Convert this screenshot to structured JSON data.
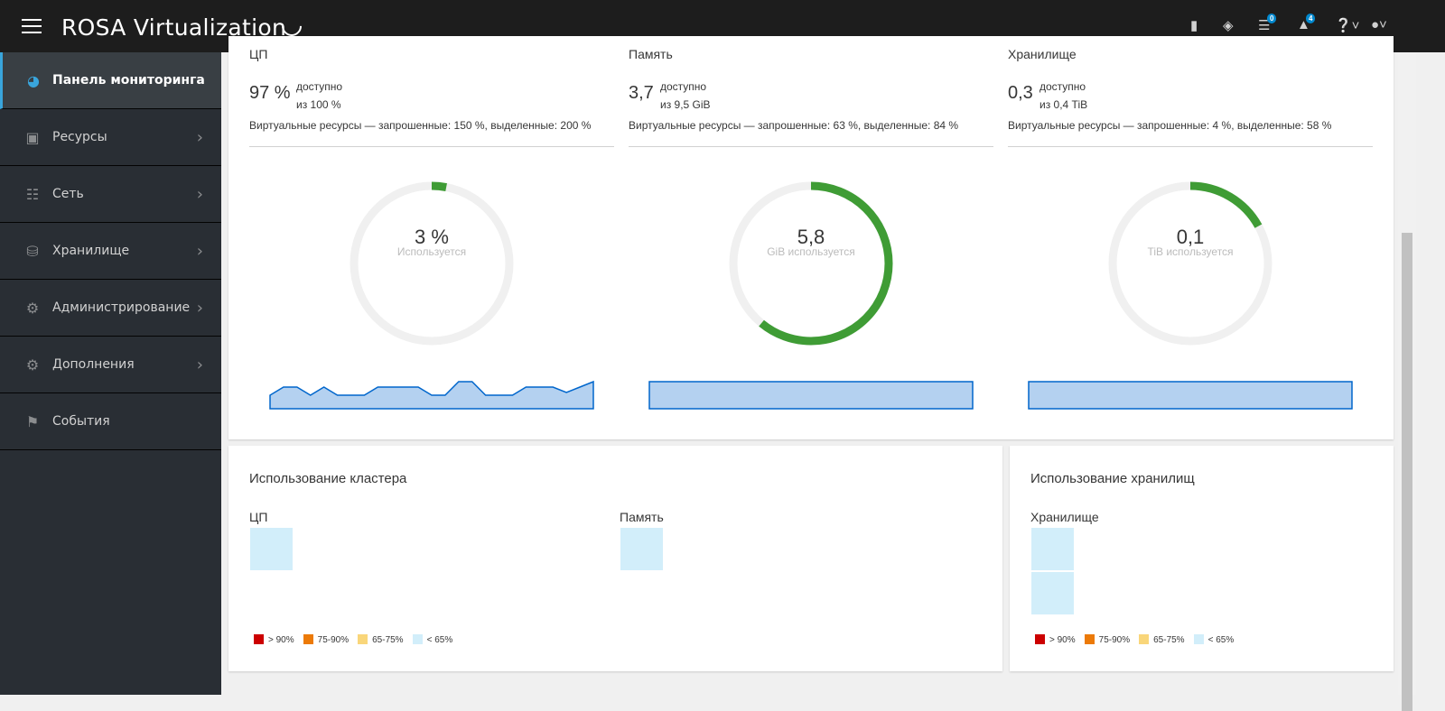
{
  "header": {
    "brand": "ROSA Virtualization",
    "messages_count": "0",
    "notifications_count": "4",
    "icons": [
      "bookmark-icon",
      "tag-icon",
      "messages-icon",
      "bell-icon",
      "help-icon",
      "user-icon"
    ]
  },
  "sidebar": {
    "items": [
      {
        "label": "Панель мониторинга",
        "icon": "dashboard-icon",
        "active": true
      },
      {
        "label": "Ресурсы",
        "icon": "chip-icon"
      },
      {
        "label": "Сеть",
        "icon": "network-icon"
      },
      {
        "label": "Хранилище",
        "icon": "database-icon"
      },
      {
        "label": "Администрирование",
        "icon": "gear-icon"
      },
      {
        "label": "Дополнения",
        "icon": "gears-icon"
      },
      {
        "label": "События",
        "icon": "flag-icon"
      }
    ]
  },
  "utilization": [
    {
      "title": "ЦП",
      "available": "97 %",
      "available_label": "доступно",
      "of": "из 100 %",
      "virtual": "Виртуальные ресурсы — запрошенные: 150 %, выделенные: 200 %",
      "used_value": "3 %",
      "used_label": "Используется",
      "used_fraction": 0.03,
      "trend": [
        5,
        8,
        8,
        5,
        8,
        5,
        5,
        5,
        8,
        8,
        8,
        8,
        5,
        5,
        10,
        10,
        5,
        5,
        5,
        8,
        8,
        8,
        6,
        8,
        10
      ]
    },
    {
      "title": "Память",
      "available": "3,7",
      "available_label": "доступно",
      "of": "из 9,5 GiB",
      "virtual": "Виртуальные ресурсы — запрошенные: 63 %, выделенные: 84 %",
      "used_value": "5,8",
      "used_label": "GiB используется",
      "used_fraction": 0.61,
      "trend": [
        10,
        10
      ]
    },
    {
      "title": "Хранилище",
      "available": "0,3",
      "available_label": "доступно",
      "of": "из 0,4 TiB",
      "virtual": "Виртуальные ресурсы — запрошенные: 4 %, выделенные: 58 %",
      "used_value": "0,1",
      "used_label": "TiB используется",
      "used_fraction": 0.17,
      "trend": [
        10,
        10
      ]
    }
  ],
  "cluster": {
    "title": "Использование кластера",
    "cpu_label": "ЦП",
    "memory_label": "Память"
  },
  "storage_usage": {
    "title": "Использование хранилищ",
    "label": "Хранилище"
  },
  "legend": [
    {
      "label": "> 90%",
      "color": "#cc0000"
    },
    {
      "label": "75-90%",
      "color": "#ec7a08"
    },
    {
      "label": "65-75%",
      "color": "#f9d67a"
    },
    {
      "label": "< 65%",
      "color": "#d2eefa"
    }
  ],
  "colors": {
    "donut_used": "#3f9c35",
    "donut_track": "#f0f0f0",
    "spark_fill": "#b4d1f0",
    "spark_line": "#0066cc"
  }
}
